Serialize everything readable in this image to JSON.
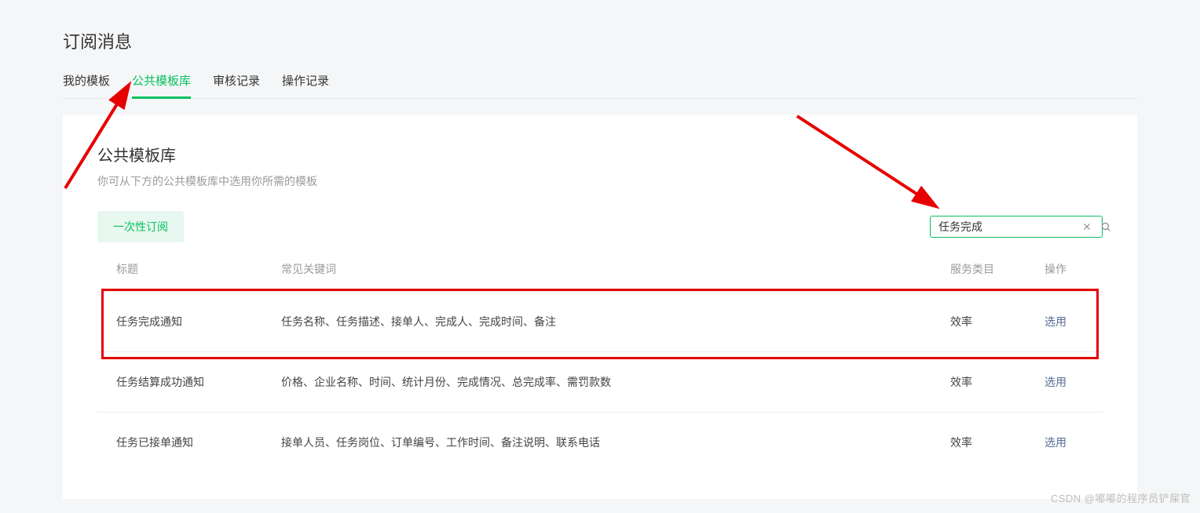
{
  "page_title": "订阅消息",
  "tabs": [
    {
      "label": "我的模板",
      "active": false
    },
    {
      "label": "公共模板库",
      "active": true
    },
    {
      "label": "审核记录",
      "active": false
    },
    {
      "label": "操作记录",
      "active": false
    }
  ],
  "panel": {
    "title": "公共模板库",
    "desc": "你可从下方的公共模板库中选用你所需的模板",
    "chip_label": "一次性订阅"
  },
  "search": {
    "value": "任务完成"
  },
  "columns": {
    "title": "标题",
    "keywords": "常见关键词",
    "category": "服务类目",
    "action": "操作"
  },
  "rows": [
    {
      "title": "任务完成通知",
      "keywords": "任务名称、任务描述、接单人、完成人、完成时间、备注",
      "category": "效率",
      "action": "选用"
    },
    {
      "title": "任务结算成功通知",
      "keywords": "价格、企业名称、时间、统计月份、完成情况、总完成率、需罚款数",
      "category": "效率",
      "action": "选用"
    },
    {
      "title": "任务已接单通知",
      "keywords": "接单人员、任务岗位、订单编号、工作时间、备注说明、联系电话",
      "category": "效率",
      "action": "选用"
    }
  ],
  "watermark": "CSDN @嘟嘟的程序员铲屎官"
}
